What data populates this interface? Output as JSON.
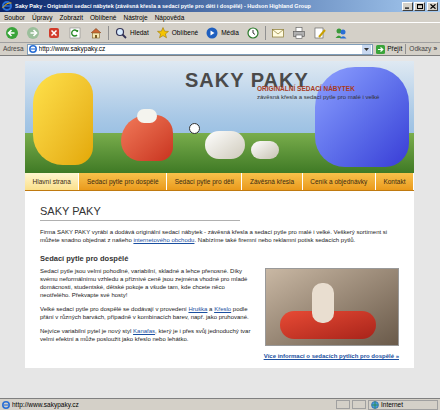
{
  "window": {
    "title": "Saky Paky - Originální sedací nábytek (závěsná křesla a sedací pytle pro děti i dospělé) - Hudson Highland Group"
  },
  "menu": [
    "Soubor",
    "Úpravy",
    "Zobrazit",
    "Oblíbené",
    "Nástroje",
    "Nápověda"
  ],
  "toolbar": {
    "search": "Hledat",
    "favorites": "Oblíbené",
    "media": "Média"
  },
  "address": {
    "label": "Adresa",
    "url": "http://www.sakypaky.cz",
    "go": "Přejít",
    "links": "Odkazy",
    "links_arrow": "»"
  },
  "site": {
    "logo": "SAKY PAKY",
    "tagline": "ORIGINÁLNÍ SEDACÍ NÁBYTEK",
    "subtitle": "závěsná křesla a sedací pytle pro malé i velké",
    "nav": [
      {
        "label": "Hlavní strana",
        "selected": true
      },
      {
        "label": "Sedací pytle pro dospělé",
        "selected": false
      },
      {
        "label": "Sedací pytle pro děti",
        "selected": false
      },
      {
        "label": "Závěsná křesla",
        "selected": false
      },
      {
        "label": "Ceník a objednávky",
        "selected": false
      },
      {
        "label": "Kontakt",
        "selected": false
      }
    ],
    "heading": "SAKY PAKY",
    "intro": [
      {
        "text": "Firma SAKY PAKY vyrábí a dodává originální sedací nábytek - závěsná křesla a sedací pytle pro malé i velké. Veškerý sortiment si můžete snadno objednat z našeho ",
        "link": false
      },
      {
        "text": "internetového obchodu",
        "link": true
      },
      {
        "text": ". Nabízíme také firemní nebo reklamní potisk sedacích pytlů.",
        "link": false
      }
    ],
    "section_title": "Sedací pytle pro dospělé",
    "paragraphs": [
      [
        {
          "text": "Sedací pytle jsou velmi pohodlné, variabilní, skladné a lehce přenosné. Díky svému neformálnímu vzhledu a příznivé ceně jsou zejména vhodné pro mladé domácnosti, studentské, dětské pokoje a všude tam, kde chcete něco neotřelého. Překvapte své hosty!",
          "link": false
        }
      ],
      [
        {
          "text": "Velké sedací pytle pro dospělé se dodávají v provedení ",
          "link": false
        },
        {
          "text": "Hruška",
          "link": true
        },
        {
          "text": " a ",
          "link": false
        },
        {
          "text": "Křeslo",
          "link": true
        },
        {
          "text": " podle přání v různých barvách, případně v kombinacích barev, např. jako pruhované.",
          "link": false
        }
      ],
      [
        {
          "text": "Nejvíce variabilní pytel je nový styl ",
          "link": false
        },
        {
          "text": "Kanafas",
          "link": true
        },
        {
          "text": ", který je i přes svůj jednoduchý tvar velmi efektní a může posloužit jako křeslo nebo lehátko.",
          "link": false
        }
      ]
    ],
    "more_link": "Více informací o sedacích pytlích pro dospělé »"
  },
  "status": {
    "url": "http://www.sakypaky.cz",
    "zone": "Internet"
  }
}
